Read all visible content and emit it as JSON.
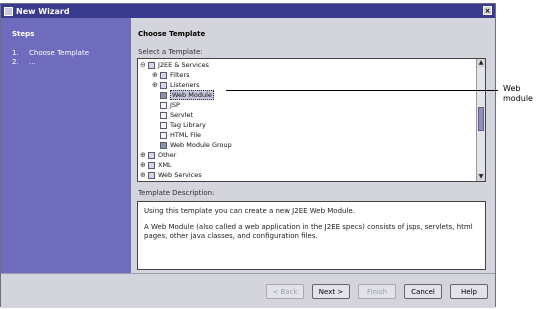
{
  "window": {
    "title": "New Wizard",
    "close_label": "×"
  },
  "steps": {
    "heading": "Steps",
    "items": [
      {
        "num": "1.",
        "label": "Choose Template"
      },
      {
        "num": "2.",
        "label": "..."
      }
    ]
  },
  "main": {
    "title": "Choose Template",
    "select_label": "Select a Template:",
    "description_label": "Template Description:"
  },
  "tree": {
    "items": [
      {
        "label": "J2EE & Services",
        "expander": "⊖"
      },
      {
        "label": "Filters",
        "expander": "⊕"
      },
      {
        "label": "Listeners",
        "expander": "⊕"
      },
      {
        "label": "Web Module",
        "expander": ""
      },
      {
        "label": "JSP",
        "expander": ""
      },
      {
        "label": "Servlet",
        "expander": ""
      },
      {
        "label": "Tag Library",
        "expander": ""
      },
      {
        "label": "HTML File",
        "expander": ""
      },
      {
        "label": "Web Module Group",
        "expander": ""
      },
      {
        "label": "Other",
        "expander": "⊕"
      },
      {
        "label": "XML",
        "expander": "⊕"
      },
      {
        "label": "Web Services",
        "expander": "⊕"
      }
    ]
  },
  "description": {
    "line1": "Using this template you can create a new J2EE Web Module.",
    "line2": "A Web Module (also called a web application in the J2EE specs) consists of jsps, servlets, html pages, other java classes, and configuration files."
  },
  "buttons": {
    "back": "< Back",
    "next": "Next >",
    "finish": "Finish",
    "cancel": "Cancel",
    "help": "Help"
  },
  "callout": {
    "line1": "Web",
    "line2": "module"
  },
  "colors": {
    "titlebar": "#3a3b8e",
    "steps_panel": "#6f6bbd",
    "dialog_bg": "#d4d4dc"
  }
}
